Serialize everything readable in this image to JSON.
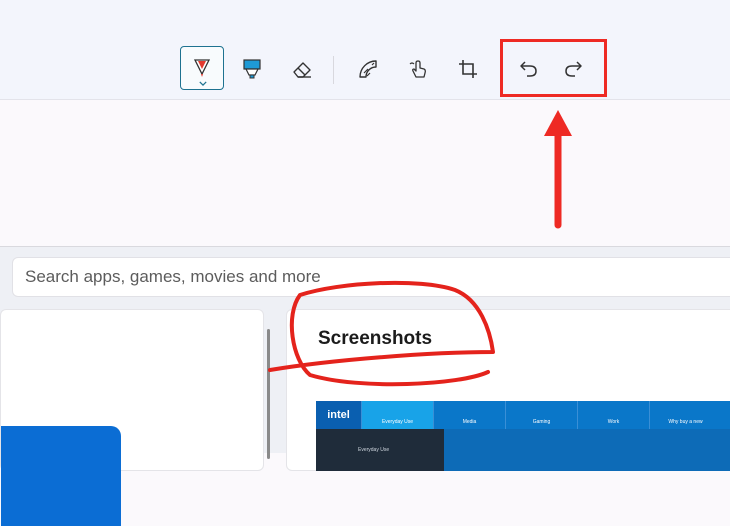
{
  "toolbar": {
    "tools": [
      {
        "name": "ballpoint-pen-icon",
        "selected": true
      },
      {
        "name": "highlighter-icon",
        "selected": false
      },
      {
        "name": "eraser-icon",
        "selected": false
      },
      {
        "name": "ruler-protractor-icon",
        "selected": false
      },
      {
        "name": "touch-writing-icon",
        "selected": false
      },
      {
        "name": "crop-icon",
        "selected": false
      },
      {
        "name": "undo-icon",
        "selected": false
      },
      {
        "name": "redo-icon",
        "selected": false
      }
    ],
    "accent_color": "#1e7290",
    "annotation_color": "#ee2a24"
  },
  "store": {
    "search_placeholder": "Search apps, games, movies and more",
    "screenshots_title": "Screenshots",
    "thumbnail": {
      "logo": "intel",
      "tabs": [
        "Everyday Use",
        "Media",
        "Gaming",
        "Work",
        "Why buy a new"
      ],
      "panel_text": "Everyday Use"
    }
  }
}
